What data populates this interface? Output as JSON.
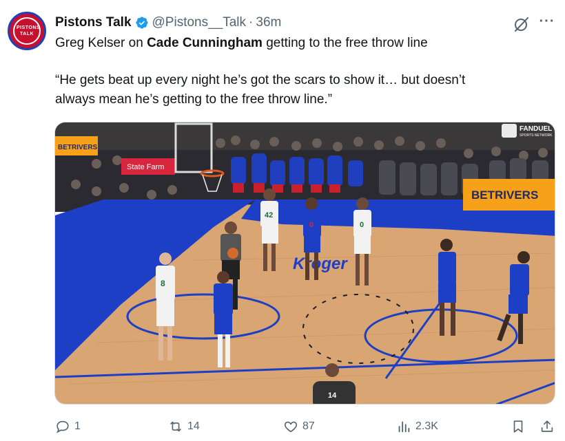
{
  "author": {
    "display_name": "Pistons Talk",
    "handle": "@Pistons__Talk",
    "separator": "·",
    "time": "36m",
    "avatar_text": "PISTONS TALK"
  },
  "tweet": {
    "line1_prefix": "Greg Kelser on ",
    "line1_bold": "Cade Cunningham",
    "line1_suffix": " getting to the free throw line",
    "quote_line1": "“He gets beat up every night he’s got the scars to show it… but doesn’t",
    "quote_line2": "always mean he’s getting to the free throw line.”"
  },
  "media": {
    "sponsor_betrivers": "BETRIVERS",
    "sponsor_statefarm": "State Farm",
    "sponsor_fanduel": "FANDUEL",
    "sponsor_fanduel_sub": "SPORTS NETWORK",
    "court_sponsor": "Kroger",
    "jersey_42": "42",
    "jersey_0_celtics": "0",
    "jersey_0_pistons": "0",
    "jersey_8": "8",
    "referee_number": "14"
  },
  "actions": {
    "replies": "1",
    "reposts": "14",
    "likes": "87",
    "views": "2.3K"
  },
  "colors": {
    "accent": "#1d9bf0",
    "muted_text": "#536471",
    "court_blue": "#1d3fc6",
    "court_wood": "#d9a572"
  }
}
